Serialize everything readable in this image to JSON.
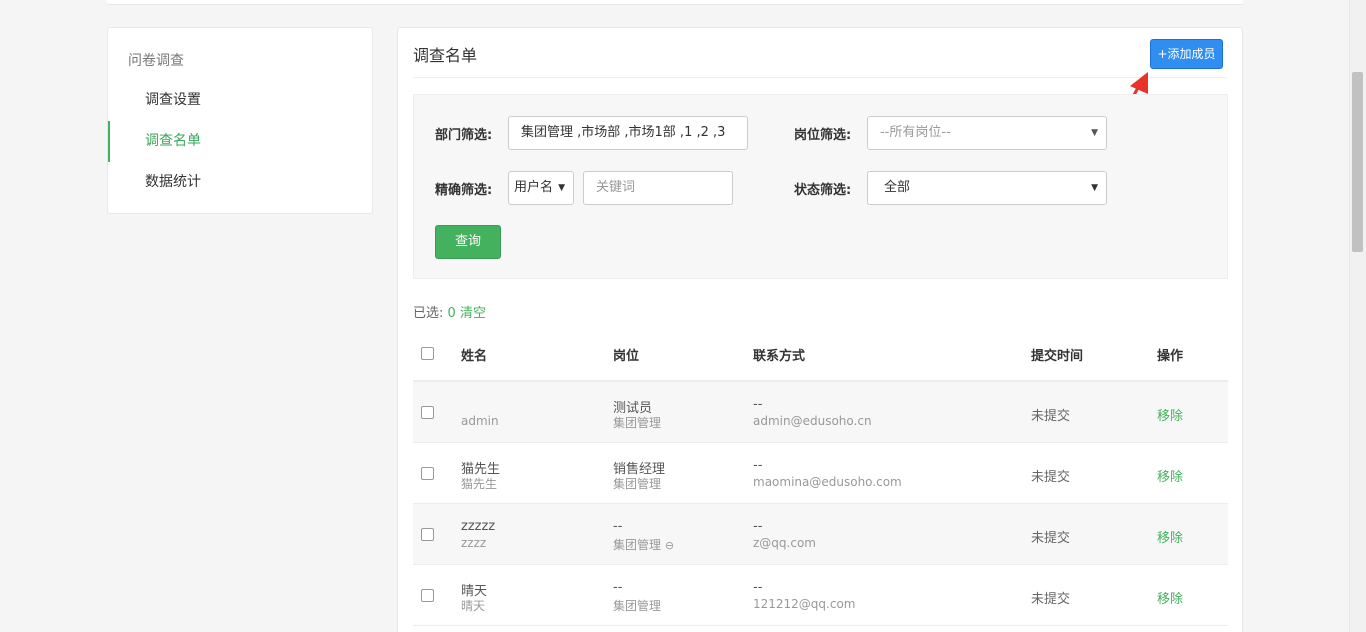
{
  "sidebar": {
    "title": "问卷调查",
    "items": [
      {
        "label": "调查设置",
        "active": false
      },
      {
        "label": "调查名单",
        "active": true
      },
      {
        "label": "数据统计",
        "active": false
      }
    ]
  },
  "main": {
    "title": "调查名单",
    "add_button": "+添加成员"
  },
  "filters": {
    "dept_label": "部门筛选:",
    "dept_value": "集团管理 ,市场部 ,市场1部 ,1 ,2 ,3",
    "position_label": "岗位筛选:",
    "position_value": "--所有岗位--",
    "exact_label": "精确筛选:",
    "exact_type": "用户名",
    "keyword_placeholder": "关键词",
    "status_label": "状态筛选:",
    "status_value": "全部",
    "query_button": "查询"
  },
  "selection": {
    "label": "已选:",
    "count": "0",
    "clear": "清空"
  },
  "table": {
    "headers": {
      "name": "姓名",
      "position": "岗位",
      "contact": "联系方式",
      "submit_time": "提交时间",
      "action": "操作"
    },
    "rows": [
      {
        "name": "",
        "username": "admin",
        "position": "测试员",
        "dept": "集团管理",
        "phone": "--",
        "email": "admin@edusoho.cn",
        "submit": "未提交",
        "action": "移除"
      },
      {
        "name": "猫先生",
        "username": "猫先生",
        "position": "销售经理",
        "dept": "集团管理",
        "phone": "--",
        "email": "maomina@edusoho.com",
        "submit": "未提交",
        "action": "移除"
      },
      {
        "name": "zzzzz",
        "username": "zzzz",
        "position": "--",
        "dept": "集团管理",
        "phone": "--",
        "email": "z@qq.com",
        "submit": "未提交",
        "action": "移除"
      },
      {
        "name": "晴天",
        "username": "晴天",
        "position": "--",
        "dept": "集团管理",
        "phone": "--",
        "email": "121212@qq.com",
        "submit": "未提交",
        "action": "移除"
      }
    ]
  },
  "colors": {
    "accent_green": "#43b15e",
    "button_blue": "#2f8ef0",
    "arrow_red": "#e8332a"
  },
  "icons": {
    "dropdown": "caret-down-icon",
    "annotation": "red-arrow-icon",
    "dept_minus": "circle-minus-icon"
  }
}
